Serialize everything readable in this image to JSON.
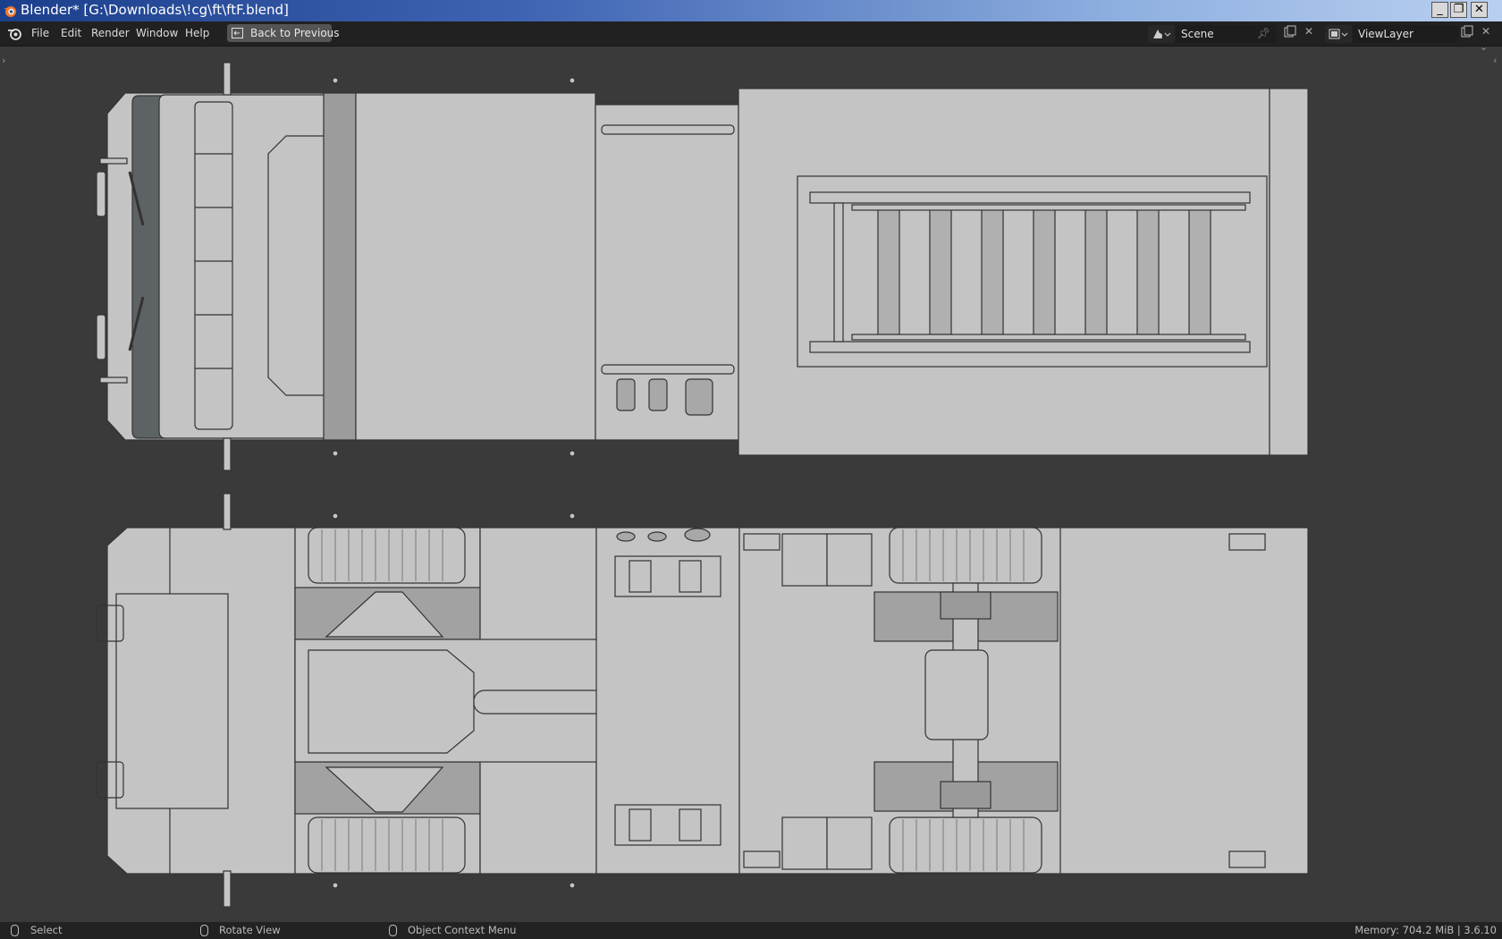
{
  "window": {
    "title": "Blender* [G:\\Downloads\\!cg\\ft\\ftF.blend]",
    "controls": {
      "minimize": "_",
      "maximize": "❐",
      "close": "✕"
    }
  },
  "topbar": {
    "menus": [
      "File",
      "Edit",
      "Render",
      "Window",
      "Help"
    ],
    "back_button_label": "Back to Previous",
    "scene": {
      "name": "Scene"
    },
    "view_layer": {
      "name": "ViewLayer"
    }
  },
  "viewport": {
    "content": "Fire truck model, top orthographic view (upper) and bottom orthographic view (lower)"
  },
  "statusbar": {
    "left_click": "Select",
    "middle_click": "Rotate View",
    "right_click": "Object Context Menu",
    "memory": "Memory: 704.2 MiB | 3.6.10"
  },
  "colors": {
    "titlebar_start": "#1c3f8c",
    "titlebar_end": "#b9cff0",
    "topbar": "#212121",
    "viewport_bg": "#3a3a3a",
    "model_fill": "#c4c4c4",
    "model_edge": "#333333"
  }
}
